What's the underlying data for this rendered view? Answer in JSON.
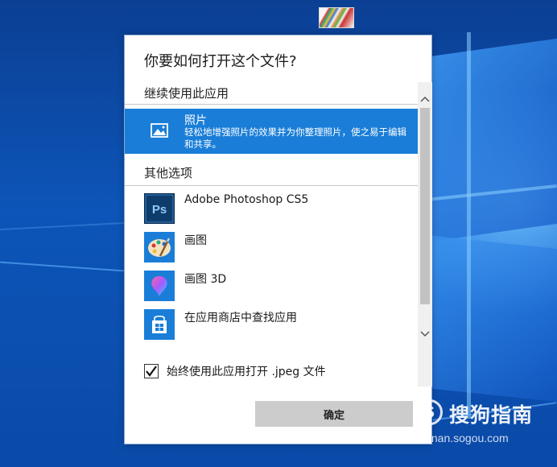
{
  "dialog": {
    "title": "你要如何打开这个文件?",
    "section_continue": "继续使用此应用",
    "section_other": "其他选项",
    "selected_app": {
      "name": "照片",
      "description": "轻松地增强照片的效果并为你整理照片，使之易于编辑和共享。",
      "icon": "photos-icon"
    },
    "other_apps": [
      {
        "name": "Adobe Photoshop CS5",
        "icon": "photoshop-icon",
        "icon_text": "Ps"
      },
      {
        "name": "画图",
        "icon": "paint-icon"
      },
      {
        "name": "画图 3D",
        "icon": "paint-3d-icon"
      },
      {
        "name": "在应用商店中查找应用",
        "icon": "store-icon"
      }
    ],
    "always_use_label": "始终使用此应用打开 .jpeg 文件",
    "always_use_checked": true,
    "ok_label": "确定"
  },
  "watermark": {
    "logo_glyph": "S",
    "text": "搜狗指南",
    "url": "zhinan.sogou.com"
  },
  "colors": {
    "selection": "#1a7ed8",
    "button": "#cccccc",
    "desktop": "#0d55b8"
  }
}
